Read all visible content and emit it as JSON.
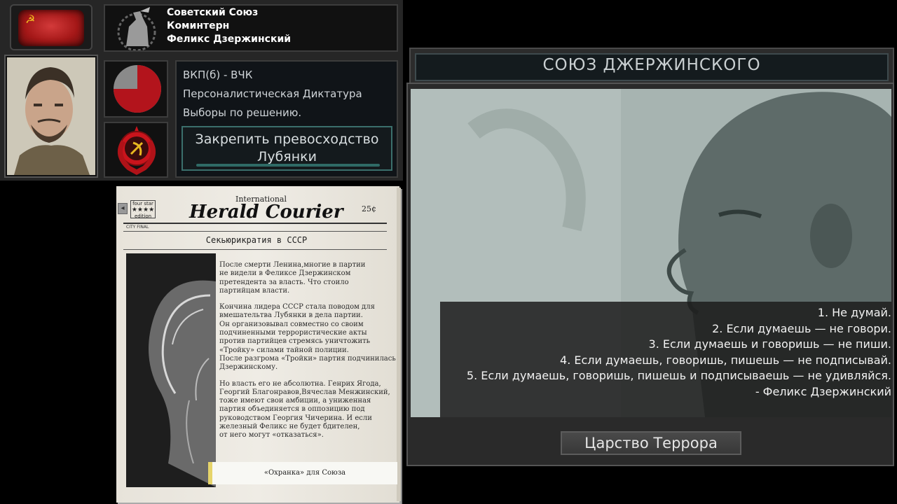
{
  "country": {
    "name": "Советский Союз",
    "ideology": "Коминтерн",
    "leader": "Феликс Дзержинский"
  },
  "government": {
    "party": "ВКП(б) - ВЧК",
    "regime": "Персоналистическая Диктатура",
    "elections": "Выборы по решению.",
    "decision_label": "Закрепить превосходство Лубянки",
    "party_popularity": 0.75
  },
  "colors": {
    "flag_red": "#b51c1c",
    "pie_red": "#b3141c",
    "pie_gray": "#8a8a8a",
    "accent_teal": "#3b6f6c"
  },
  "newspaper": {
    "international": "International",
    "masthead": "Herald Courier",
    "price": "25¢",
    "stars_text": "four star",
    "stars": "★★★★",
    "stars_sub": "edition",
    "city_final": "CITY FINAL",
    "headline": "Секьюрикратия в СССР",
    "paragraphs": [
      "После смерти Ленина,многие в партии\nне видели в Феликсе Дзержинском\nпретендента за власть. Что стоило\nпартийцам власти.",
      "Кончина лидера СССР стала поводом для\nвмешательтва Лубянки в дела партии.\nОн организовывал совместно со своим\nподчиненными террористические акты\nпротив партийцев стремясь уничтожить\n«Тройку» силами тайной полиции.\nПосле разгрома «Тройки» партия подчинилась\nДзержинскому.",
      "Но власть его не абсолютна. Генрих Ягода,\nГеоргий Благонравов,Вячеслав Менжинский,\nтоже имеют свои амбиции, а униженная\nпартия объединяется в оппозицию под\nруководством Георгия Чичерина. И если\nжелезный Феликс не будет бдителен,\nот него могут «отказаться»."
    ],
    "caption": "«Охранка» для Союза"
  },
  "event": {
    "title": "СОЮЗ ДЖЕРЖИНСКОГО",
    "quote_lines": [
      "1. Не думай.",
      "2. Если думаешь — не говори.",
      "3. Если думаешь и говоришь — не пиши.",
      "4. Если думаешь, говоришь, пишешь — не подписывай.",
      "5. Если думаешь, говоришь, пишешь и подписываешь — не удивляйся.",
      "- Феликс Дзержинский"
    ],
    "option_label": "Царство Террора"
  }
}
